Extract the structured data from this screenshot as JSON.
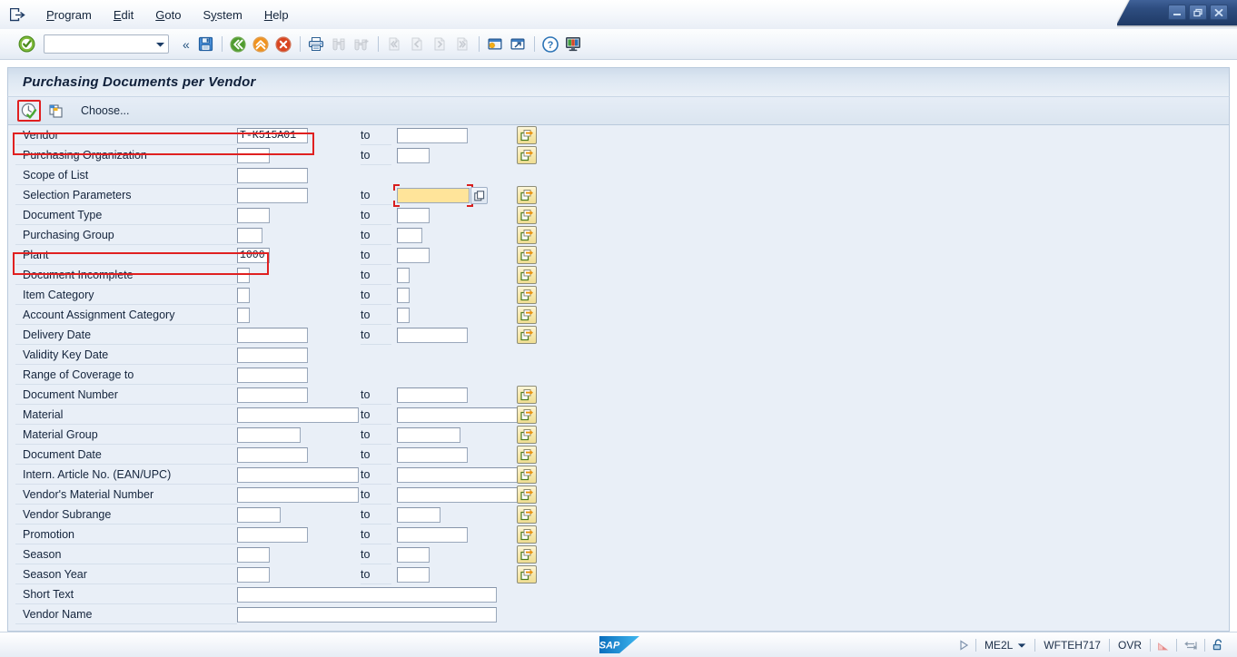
{
  "window": {
    "controls": [
      {
        "name": "minimize",
        "glyph": "minimize-icon"
      },
      {
        "name": "restore",
        "glyph": "restore-icon"
      },
      {
        "name": "close",
        "glyph": "close-icon"
      }
    ]
  },
  "menubar": {
    "logo_icon": "sap-exit-icon",
    "items": [
      {
        "label": "Program",
        "accel": "P"
      },
      {
        "label": "Edit",
        "accel": "E"
      },
      {
        "label": "Goto",
        "accel": "G"
      },
      {
        "label": "System",
        "accel": "y"
      },
      {
        "label": "Help",
        "accel": "H"
      }
    ]
  },
  "toolbar": {
    "enter_icon": "green-check-icon",
    "command_field": {
      "value": "",
      "placeholder": ""
    },
    "command_dropdown_icon": "chevron-down-icon",
    "back_chevron": "«",
    "buttons": [
      {
        "name": "save",
        "icon": "save-icon",
        "enabled": true
      },
      {
        "name": "back",
        "icon": "back-green-arrow-icon",
        "enabled": true
      },
      {
        "name": "exit",
        "icon": "exit-orange-arrow-icon",
        "enabled": true
      },
      {
        "name": "cancel",
        "icon": "cancel-red-icon",
        "enabled": true
      },
      {
        "name": "print",
        "icon": "printer-icon",
        "enabled": true
      },
      {
        "name": "find",
        "icon": "binoculars-icon",
        "enabled": false
      },
      {
        "name": "find-next",
        "icon": "binoculars-plus-icon",
        "enabled": false
      },
      {
        "name": "first-page",
        "icon": "first-page-icon",
        "enabled": false
      },
      {
        "name": "previous-page",
        "icon": "previous-page-icon",
        "enabled": false
      },
      {
        "name": "next-page",
        "icon": "next-page-icon",
        "enabled": false
      },
      {
        "name": "last-page",
        "icon": "last-page-icon",
        "enabled": false
      },
      {
        "name": "create-session",
        "icon": "new-session-icon",
        "enabled": true
      },
      {
        "name": "create-shortcut",
        "icon": "shortcut-icon",
        "enabled": true
      },
      {
        "name": "help",
        "icon": "question-help-icon",
        "enabled": true
      },
      {
        "name": "customize-local-layout",
        "icon": "layout-monitor-icon",
        "enabled": true
      }
    ]
  },
  "program": {
    "title": "Purchasing Documents per Vendor"
  },
  "app_toolbar": {
    "execute_icon": "execute-clock-check-icon",
    "execute_highlighted": true,
    "multiple_selection_icon": "copy-variant-icon",
    "choose_label": "Choose..."
  },
  "selection_screen": {
    "to_label": "to",
    "multi_select_icon": "multiple-selection-arrow-icon",
    "rows": [
      {
        "label": "Vendor",
        "low": "T-K515A01",
        "low_w": 78,
        "has_to": true,
        "high": "",
        "high_w": 78,
        "has_ms": true,
        "mono": true,
        "highlight": true
      },
      {
        "label": "Purchasing Organization",
        "low": "",
        "low_w": 36,
        "has_to": true,
        "high": "",
        "high_w": 36,
        "has_ms": true,
        "mono": false,
        "highlight": false
      },
      {
        "label": "Scope of List",
        "low": "",
        "low_w": 78,
        "has_to": false,
        "high": "",
        "high_w": 0,
        "has_ms": false,
        "mono": false,
        "highlight": false
      },
      {
        "label": "Selection Parameters",
        "low": "",
        "low_w": 78,
        "has_to": true,
        "high": "",
        "high_w": 80,
        "has_ms": true,
        "mono": false,
        "highlight": false,
        "focused_high": true
      },
      {
        "label": "Document Type",
        "low": "",
        "low_w": 36,
        "has_to": true,
        "high": "",
        "high_w": 36,
        "has_ms": true,
        "mono": false,
        "highlight": false
      },
      {
        "label": "Purchasing Group",
        "low": "",
        "low_w": 28,
        "has_to": true,
        "high": "",
        "high_w": 28,
        "has_ms": true,
        "mono": false,
        "highlight": false
      },
      {
        "label": "Plant",
        "low": "1000",
        "low_w": 36,
        "has_to": true,
        "high": "",
        "high_w": 36,
        "has_ms": true,
        "mono": true,
        "highlight": true
      },
      {
        "label": "Document Incomplete",
        "low": "",
        "low_w": 14,
        "has_to": true,
        "high": "",
        "high_w": 14,
        "has_ms": true,
        "mono": false,
        "highlight": false
      },
      {
        "label": "Item Category",
        "low": "",
        "low_w": 14,
        "has_to": true,
        "high": "",
        "high_w": 14,
        "has_ms": true,
        "mono": false,
        "highlight": false
      },
      {
        "label": "Account Assignment Category",
        "low": "",
        "low_w": 14,
        "has_to": true,
        "high": "",
        "high_w": 14,
        "has_ms": true,
        "mono": false,
        "highlight": false
      },
      {
        "label": "Delivery Date",
        "low": "",
        "low_w": 78,
        "has_to": true,
        "high": "",
        "high_w": 78,
        "has_ms": true,
        "mono": false,
        "highlight": false
      },
      {
        "label": "Validity Key Date",
        "low": "",
        "low_w": 78,
        "has_to": false,
        "high": "",
        "high_w": 0,
        "has_ms": false,
        "mono": false,
        "highlight": false
      },
      {
        "label": "Range of Coverage to",
        "low": "",
        "low_w": 78,
        "has_to": false,
        "high": "",
        "high_w": 0,
        "has_ms": false,
        "mono": false,
        "highlight": false
      },
      {
        "label": "Document Number",
        "low": "",
        "low_w": 78,
        "has_to": true,
        "high": "",
        "high_w": 78,
        "has_ms": true,
        "mono": false,
        "highlight": false
      },
      {
        "label": "Material",
        "low": "",
        "low_w": 134,
        "has_to": true,
        "high": "",
        "high_w": 134,
        "has_ms": true,
        "mono": false,
        "highlight": false
      },
      {
        "label": "Material Group",
        "low": "",
        "low_w": 70,
        "has_to": true,
        "high": "",
        "high_w": 70,
        "has_ms": true,
        "mono": false,
        "highlight": false
      },
      {
        "label": "Document Date",
        "low": "",
        "low_w": 78,
        "has_to": true,
        "high": "",
        "high_w": 78,
        "has_ms": true,
        "mono": false,
        "highlight": false
      },
      {
        "label": "Intern. Article No. (EAN/UPC)",
        "low": "",
        "low_w": 134,
        "has_to": true,
        "high": "",
        "high_w": 134,
        "has_ms": true,
        "mono": false,
        "highlight": false
      },
      {
        "label": "Vendor's Material Number",
        "low": "",
        "low_w": 134,
        "has_to": true,
        "high": "",
        "high_w": 134,
        "has_ms": true,
        "mono": false,
        "highlight": false
      },
      {
        "label": "Vendor Subrange",
        "low": "",
        "low_w": 48,
        "has_to": true,
        "high": "",
        "high_w": 48,
        "has_ms": true,
        "mono": false,
        "highlight": false
      },
      {
        "label": "Promotion",
        "low": "",
        "low_w": 78,
        "has_to": true,
        "high": "",
        "high_w": 78,
        "has_ms": true,
        "mono": false,
        "highlight": false
      },
      {
        "label": "Season",
        "low": "",
        "low_w": 36,
        "has_to": true,
        "high": "",
        "high_w": 36,
        "has_ms": true,
        "mono": false,
        "highlight": false
      },
      {
        "label": "Season Year",
        "low": "",
        "low_w": 36,
        "has_to": true,
        "high": "",
        "high_w": 36,
        "has_ms": true,
        "mono": false,
        "highlight": false
      },
      {
        "label": "Short Text",
        "low": "",
        "low_w": 286,
        "has_to": false,
        "high": "",
        "high_w": 0,
        "has_ms": false,
        "mono": false,
        "highlight": false
      },
      {
        "label": "Vendor Name",
        "low": "",
        "low_w": 286,
        "has_to": false,
        "high": "",
        "high_w": 0,
        "has_ms": false,
        "mono": false,
        "highlight": false
      }
    ]
  },
  "statusbar": {
    "sap_logo_text": "SAP",
    "status_arrow_icon": "play-triangle-icon",
    "transaction": "ME2L",
    "transaction_dropdown_icon": "chevron-down-icon",
    "system": "WFTEH717",
    "insert_mode": "OVR",
    "signal_icon": "response-time-icon",
    "server_icon": "data-transfer-icon",
    "lock_icon": "unlocked-padlock-icon"
  },
  "colors": {
    "accent_blue": "#2e4d80",
    "screen_bg": "#e9eff7",
    "highlight_red": "#e02020",
    "focus_yellow": "#ffe49a",
    "ms_button": "#f6e8ae"
  }
}
